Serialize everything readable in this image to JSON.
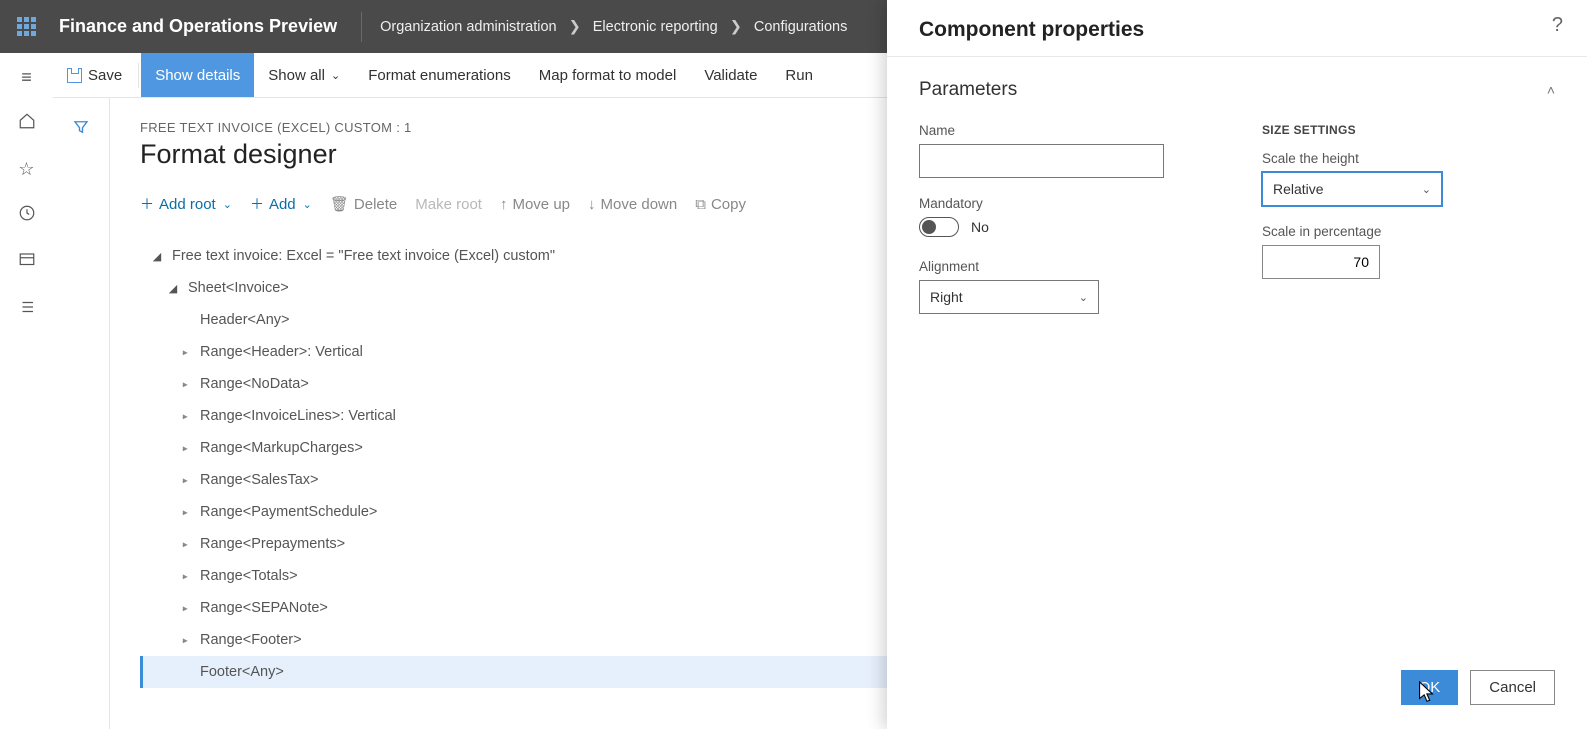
{
  "app_title": "Finance and Operations Preview",
  "breadcrumbs": [
    "Organization administration",
    "Electronic reporting",
    "Configurations"
  ],
  "toolbar": {
    "save": "Save",
    "show_details": "Show details",
    "show_all": "Show all",
    "format_enum": "Format enumerations",
    "map_format": "Map format to model",
    "validate": "Validate",
    "run": "Run"
  },
  "page": {
    "subheading": "FREE TEXT INVOICE (EXCEL) CUSTOM : 1",
    "heading": "Format designer"
  },
  "actions": {
    "add_root": "Add root",
    "add": "Add",
    "delete": "Delete",
    "make_root": "Make root",
    "move_up": "Move up",
    "move_down": "Move down",
    "copy": "Copy"
  },
  "tree": {
    "root": "Free text invoice: Excel = \"Free text invoice (Excel) custom\"",
    "sheet": "Sheet<Invoice>",
    "items": [
      "Header<Any>",
      "Range<Header>: Vertical",
      "Range<NoData>",
      "Range<InvoiceLines>: Vertical",
      "Range<MarkupCharges>",
      "Range<SalesTax>",
      "Range<PaymentSchedule>",
      "Range<Prepayments>",
      "Range<Totals>",
      "Range<SEPANote>",
      "Range<Footer>",
      "Footer<Any>"
    ]
  },
  "panel": {
    "title": "Component properties",
    "section": "Parameters",
    "name_label": "Name",
    "name_value": "",
    "mandatory_label": "Mandatory",
    "mandatory_value": "No",
    "alignment_label": "Alignment",
    "alignment_value": "Right",
    "size_heading": "SIZE SETTINGS",
    "scale_height_label": "Scale the height",
    "scale_height_value": "Relative",
    "scale_pct_label": "Scale in percentage",
    "scale_pct_value": "70",
    "ok": "OK",
    "cancel": "Cancel"
  }
}
